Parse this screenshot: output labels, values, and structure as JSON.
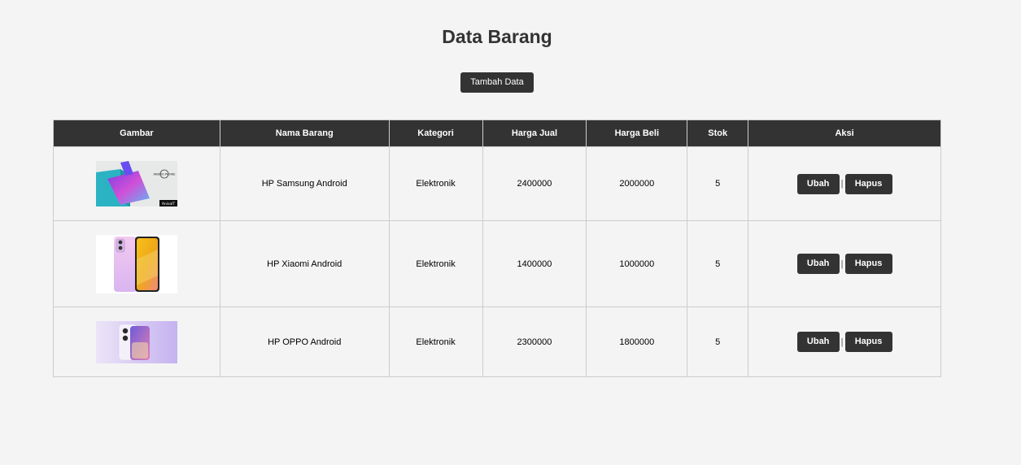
{
  "page": {
    "title": "Data Barang",
    "add_button_label": "Tambah Data"
  },
  "table": {
    "headers": [
      "Gambar",
      "Nama Barang",
      "Kategori",
      "Harga Jual",
      "Harga Beli",
      "Stok",
      "Aksi"
    ],
    "rows": [
      {
        "name": "HP Samsung Android",
        "category": "Elektronik",
        "sell_price": "2400000",
        "buy_price": "2000000",
        "stock": "5",
        "image_caption": "AnisaIT",
        "image_logo": "ANDRO PHONE"
      },
      {
        "name": "HP Xiaomi Android",
        "category": "Elektronik",
        "sell_price": "1400000",
        "buy_price": "1000000",
        "stock": "5"
      },
      {
        "name": "HP OPPO Android",
        "category": "Elektronik",
        "sell_price": "2300000",
        "buy_price": "1800000",
        "stock": "5"
      }
    ],
    "edit_label": "Ubah",
    "delete_label": "Hapus",
    "separator": "|"
  },
  "colors": {
    "background": "#f4f4f4",
    "header_bg": "#333333",
    "button_bg": "#333333",
    "border": "#cccccc"
  }
}
